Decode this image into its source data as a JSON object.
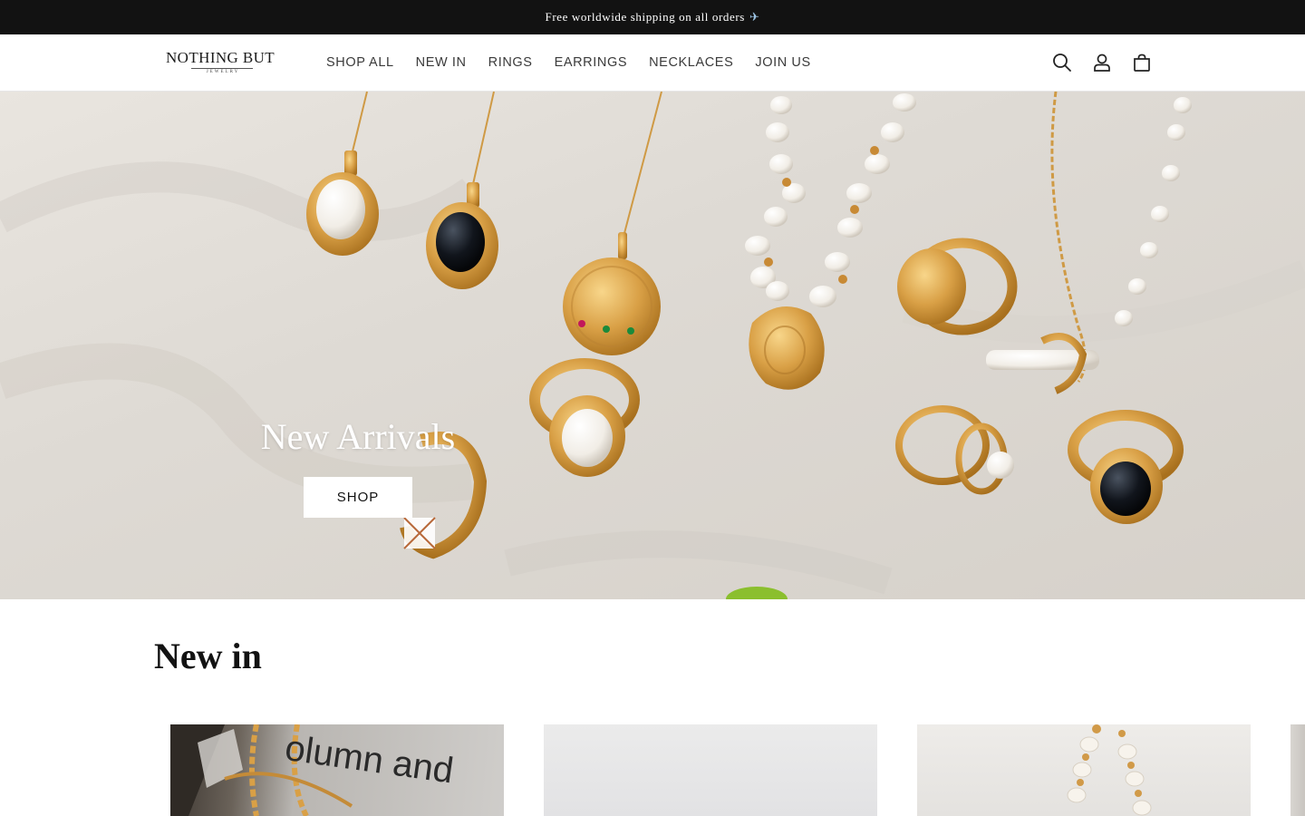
{
  "announcement": {
    "text": "Free worldwide shipping on all orders",
    "icon": "airplane-icon"
  },
  "header": {
    "logo": {
      "main": "NOTHING BUT",
      "sub": "JEWELRY"
    },
    "nav": [
      {
        "label": "SHOP ALL"
      },
      {
        "label": "NEW IN"
      },
      {
        "label": "RINGS"
      },
      {
        "label": "EARRINGS"
      },
      {
        "label": "NECKLACES"
      },
      {
        "label": "JOIN US"
      }
    ],
    "icons": [
      "search-icon",
      "account-icon",
      "cart-icon"
    ]
  },
  "hero": {
    "title": "New Arrivals",
    "button_label": "SHOP"
  },
  "new_in": {
    "title": "New in",
    "products": [
      {
        "image_text": "olumn and"
      },
      {
        "image_text": ""
      },
      {
        "image_text": ""
      }
    ]
  },
  "colors": {
    "announcement_bg": "#121212",
    "gold": "#d9a046",
    "text": "#121212"
  }
}
